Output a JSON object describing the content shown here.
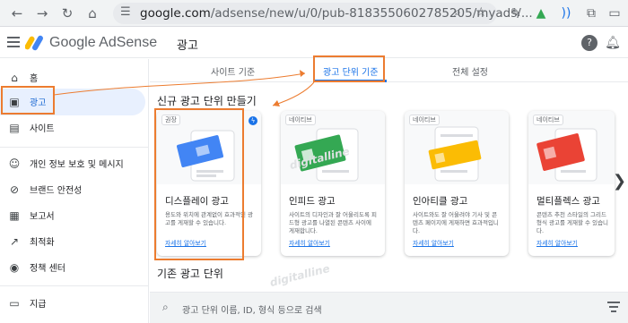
{
  "browser": {
    "url_host": "google.com",
    "url_path": "/adsense/new/u/0/pub-8183550602785205/myads/...",
    "icons": [
      "back-icon",
      "forward-icon",
      "reload-icon",
      "home-icon",
      "tune-icon",
      "zoom-icon",
      "star-icon",
      "pen-icon",
      "drive-icon",
      "audio-icon",
      "puzzle-icon",
      "window-icon"
    ]
  },
  "header": {
    "product": "Google AdSense",
    "page_title": "광고",
    "icons": [
      "help-icon",
      "notifications-icon"
    ]
  },
  "sidebar": {
    "items": [
      {
        "label": "홈",
        "icon": "home-icon"
      },
      {
        "label": "광고",
        "icon": "ads-icon"
      },
      {
        "label": "사이트",
        "icon": "sites-icon"
      },
      {
        "label": "개인 정보 보호 및 메시지",
        "icon": "privacy-icon"
      },
      {
        "label": "브랜드 안전성",
        "icon": "brand-safety-icon"
      },
      {
        "label": "보고서",
        "icon": "reports-icon"
      },
      {
        "label": "최적화",
        "icon": "optimization-icon"
      },
      {
        "label": "정책 센터",
        "icon": "policy-icon"
      },
      {
        "label": "지급",
        "icon": "payments-icon"
      }
    ]
  },
  "tabs": [
    {
      "label": "사이트 기준"
    },
    {
      "label": "광고 단위 기준"
    },
    {
      "label": "전체 설정"
    }
  ],
  "new_section_title": "신규 광고 단위 만들기",
  "existing_section_title": "기존 광고 단위",
  "cards": [
    {
      "badge": "권장",
      "name": "디스플레이 광고",
      "desc": "용도와 위치에 관계없이 효과적인 광고를 게재할 수 있습니다.",
      "link": "자세히 알아보기"
    },
    {
      "badge": "네이티브",
      "name": "인피드 광고",
      "desc": "사이트의 디자인과 잘 어울리도록 피드형 광고를 나열된 콘텐츠 사이에 게재합니다.",
      "link": "자세히 알아보기"
    },
    {
      "badge": "네이티브",
      "name": "인아티클 광고",
      "desc": "사이트와도 잘 어울려야 기사 및 콘텐츠 페이지에 게재하면 효과적입니다.",
      "link": "자세히 알아보기"
    },
    {
      "badge": "네이티브",
      "name": "멀티플렉스 광고",
      "desc": "콘텐츠 추천 스타일의 그리드 형식 광고를 게재할 수 있습니다.",
      "link": "자세히 알아보기"
    }
  ],
  "search": {
    "placeholder": "광고 단위 이름, ID, 형식 등으로 검색"
  },
  "watermark": "digitalline",
  "colors": {
    "accent": "#1a73e8",
    "highlight_box": "#ec7c30",
    "active_bg": "#e8f0fe"
  }
}
